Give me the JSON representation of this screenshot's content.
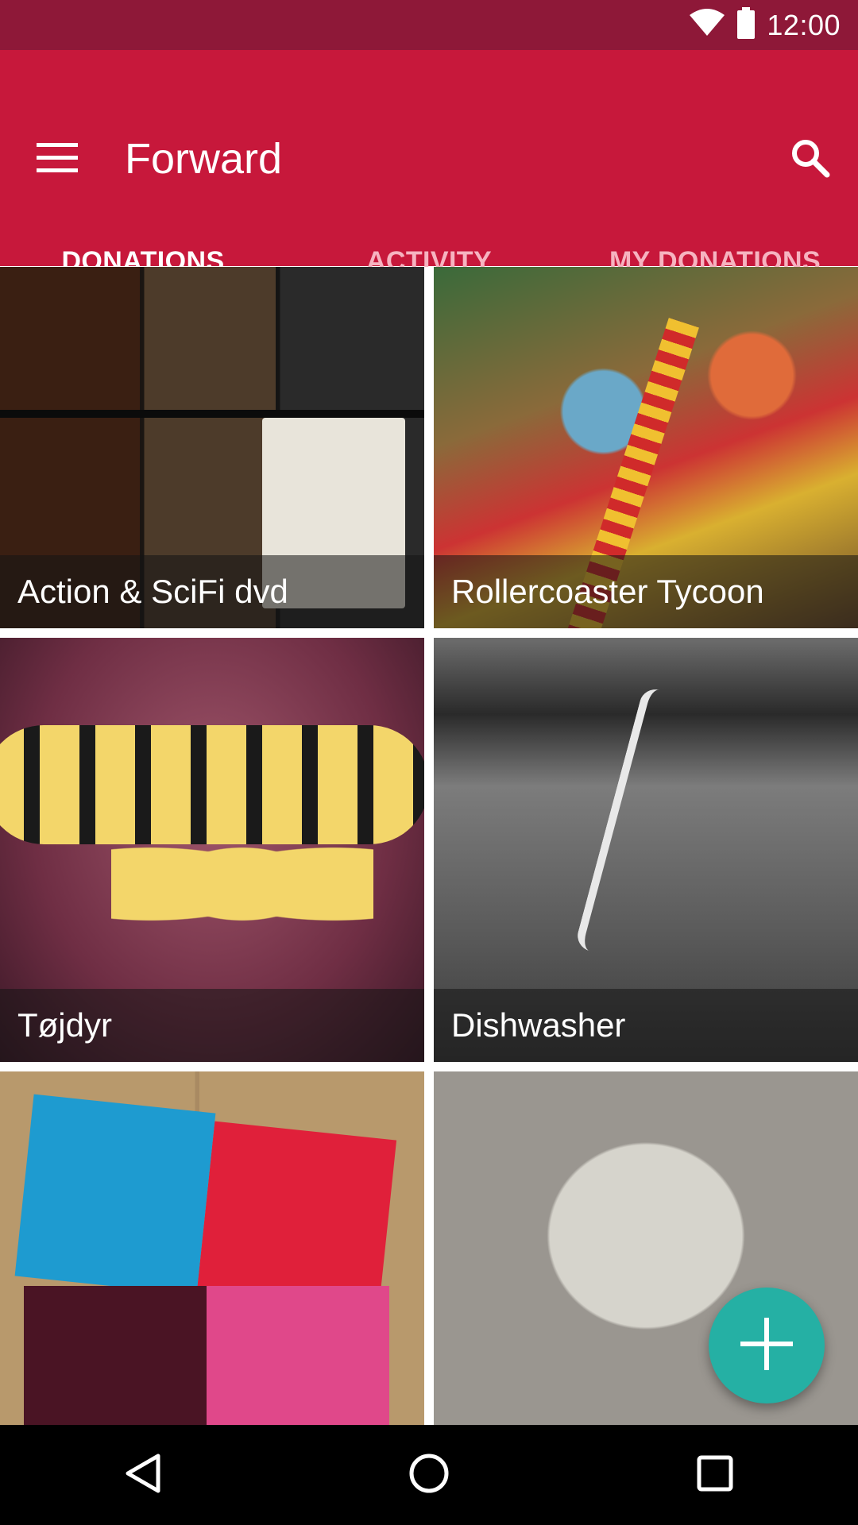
{
  "status_bar": {
    "time": "12:00",
    "icons": [
      "wifi-icon",
      "battery-icon"
    ]
  },
  "app_bar": {
    "title": "Forward",
    "menu_icon": "menu-icon",
    "search_icon": "search-icon",
    "background_color": "#c7183b"
  },
  "tabs": [
    {
      "label": "DONATIONS",
      "active": true
    },
    {
      "label": "ACTIVITY",
      "active": false
    },
    {
      "label": "MY DONATIONS",
      "active": false
    }
  ],
  "donations": [
    {
      "title": "Action & SciFi dvd"
    },
    {
      "title": "Rollercoaster Tycoon"
    },
    {
      "title": "Tøjdyr"
    },
    {
      "title": "Dishwasher"
    },
    {
      "title": ""
    },
    {
      "title": ""
    }
  ],
  "fab": {
    "icon": "plus-icon",
    "color": "#25b0a4"
  },
  "nav_bar": {
    "icons": [
      "back-icon",
      "home-icon",
      "recents-icon"
    ]
  }
}
